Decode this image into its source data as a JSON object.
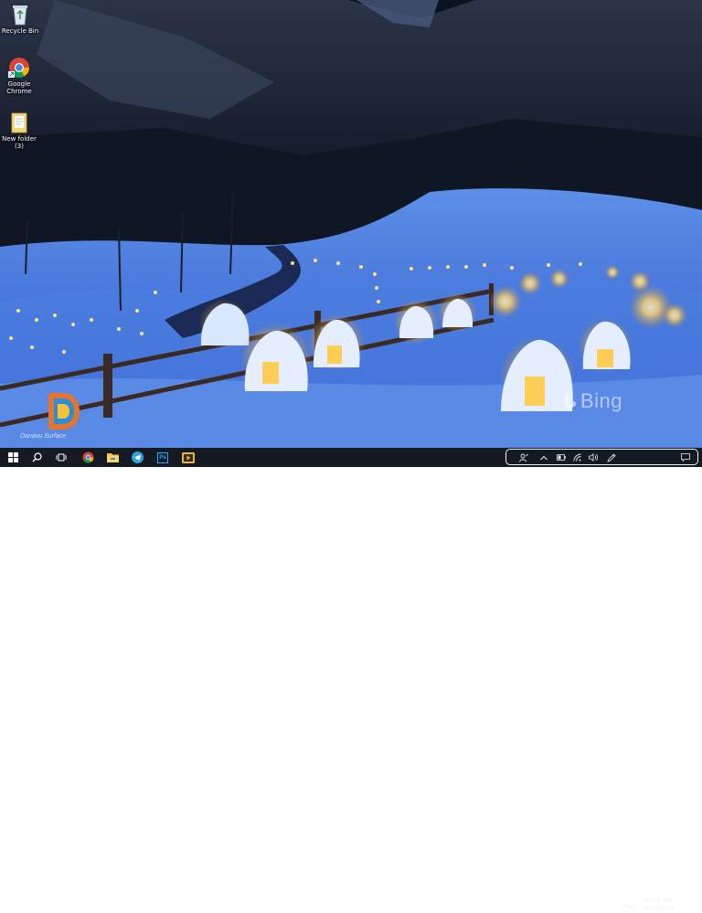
{
  "desktop": {
    "icons": [
      {
        "label_1": "Recycle Bin",
        "label_2": "",
        "icon": "recycle-bin-icon"
      },
      {
        "label_1": "Google",
        "label_2": "Chrome",
        "icon": "chrome-icon"
      },
      {
        "label_1": "New folder",
        "label_2": "(3)",
        "icon": "folder-icon"
      }
    ],
    "watermark": "Bing",
    "brand_text": "Danavu Surface"
  },
  "taskbar": {
    "pinned": [
      "windows-start-icon",
      "search-icon",
      "task-view-icon",
      "chrome-icon",
      "file-explorer-icon",
      "telegram-icon",
      "photoshop-icon",
      "media-player-icon"
    ],
    "photoshop_label": "Ps",
    "tray": {
      "language": "ENG",
      "time": "11:06 AM",
      "date": "2/16/2019"
    }
  },
  "colors": {
    "taskbar": "#141922",
    "accent": "#f2f2f2"
  }
}
